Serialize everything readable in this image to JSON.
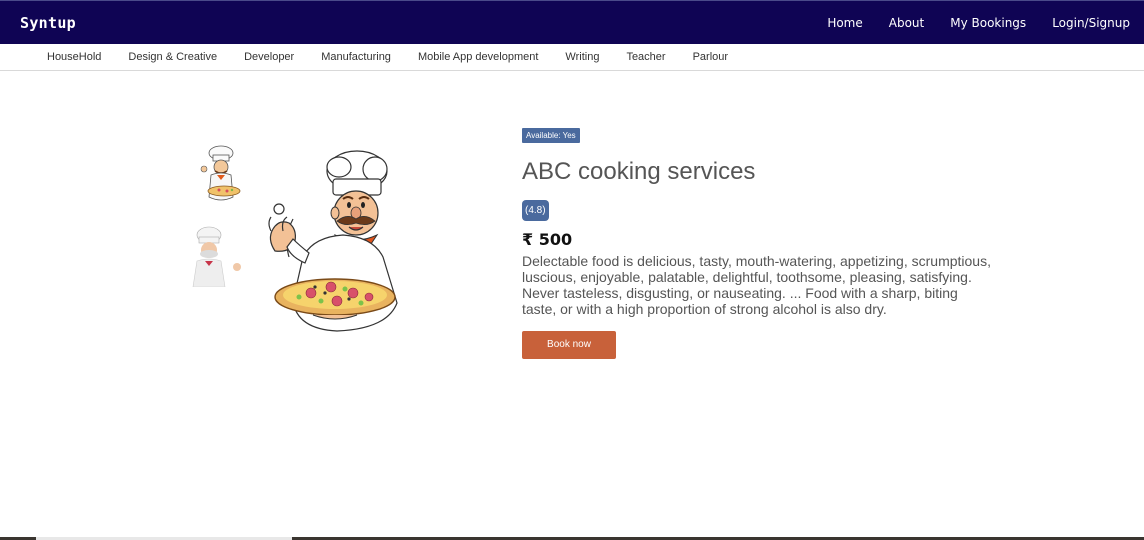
{
  "header": {
    "brand": "Syntup",
    "nav": [
      "Home",
      "About",
      "My Bookings",
      "Login/Signup"
    ]
  },
  "categories": [
    "HouseHold",
    "Design & Creative",
    "Developer",
    "Manufacturing",
    "Mobile App development",
    "Writing",
    "Teacher",
    "Parlour"
  ],
  "service": {
    "availability": "Available: Yes",
    "title": "ABC cooking services",
    "rating": "(4.8)",
    "price": "₹ 500",
    "description": "Delectable food is delicious, tasty, mouth-watering, appetizing, scrumptious, luscious, enjoyable, palatable, delightful, toothsome, pleasing, satisfying. Never tasteless, disgusting, or nauseating. ... Food with a sharp, biting taste, or with a high proportion of strong alcohol is also dry.",
    "book_label": "Book now"
  },
  "colors": {
    "header_bg": "#0f0454",
    "badge_bg": "#4a6a9e",
    "button_bg": "#c8613a"
  },
  "images": {
    "main": "chef-with-pizza-illustration",
    "thumb1": "chef-with-pizza-thumbnail",
    "thumb2": "chef-thumbnail"
  }
}
